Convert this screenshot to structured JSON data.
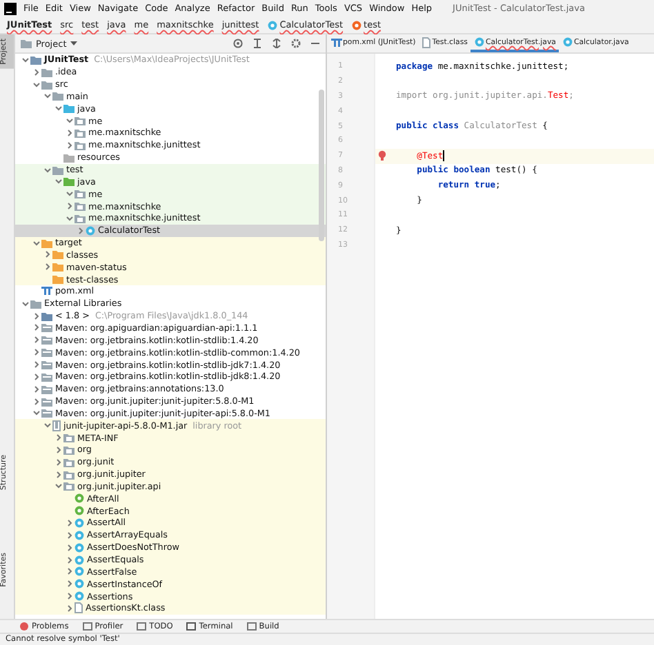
{
  "menu": [
    "File",
    "Edit",
    "View",
    "Navigate",
    "Code",
    "Analyze",
    "Refactor",
    "Build",
    "Run",
    "Tools",
    "VCS",
    "Window",
    "Help"
  ],
  "window": {
    "title": "JUnitTest - CalculatorTest.java"
  },
  "breadcrumbs": [
    {
      "label": "JUnitTest",
      "kind": "module"
    },
    {
      "label": "src",
      "kind": "folder"
    },
    {
      "label": "test",
      "kind": "folder"
    },
    {
      "label": "java",
      "kind": "folder"
    },
    {
      "label": "me",
      "kind": "folder"
    },
    {
      "label": "maxnitschke",
      "kind": "folder"
    },
    {
      "label": "junittest",
      "kind": "folder"
    },
    {
      "label": "CalculatorTest",
      "kind": "class"
    },
    {
      "label": "test",
      "kind": "method"
    }
  ],
  "side_stripe": [
    {
      "label": "Project",
      "selected": true
    },
    {
      "label": "Structure",
      "selected": false
    },
    {
      "label": "Favorites",
      "selected": false
    }
  ],
  "project": {
    "title": "Project",
    "tree": [
      {
        "label": "JUnitTest",
        "hint": "C:\\Users\\Max\\IdeaProjects\\JUnitTest",
        "kind": "module",
        "expanded": true,
        "children": [
          {
            "label": ".idea",
            "kind": "folder",
            "expanded": false
          },
          {
            "label": "src",
            "kind": "folder",
            "expanded": true,
            "children": [
              {
                "label": "main",
                "kind": "folder",
                "expanded": true,
                "children": [
                  {
                    "label": "java",
                    "kind": "source",
                    "expanded": true,
                    "children": [
                      {
                        "label": "me",
                        "kind": "package",
                        "expanded": true
                      },
                      {
                        "label": "me.maxnitschke",
                        "kind": "package",
                        "expanded": false
                      },
                      {
                        "label": "me.maxnitschke.junittest",
                        "kind": "package",
                        "expanded": false
                      }
                    ]
                  },
                  {
                    "label": "resources",
                    "kind": "resources"
                  }
                ]
              },
              {
                "label": "test",
                "kind": "folder",
                "color": "#eff9ea",
                "expanded": true,
                "children": [
                  {
                    "label": "java",
                    "kind": "test",
                    "expanded": true,
                    "children": [
                      {
                        "label": "me",
                        "kind": "package",
                        "expanded": true
                      },
                      {
                        "label": "me.maxnitschke",
                        "kind": "package",
                        "expanded": false
                      },
                      {
                        "label": "me.maxnitschke.junittest",
                        "kind": "package",
                        "expanded": true,
                        "children": [
                          {
                            "label": "CalculatorTest",
                            "kind": "class",
                            "expanded": false,
                            "selected": true
                          }
                        ]
                      }
                    ]
                  }
                ]
              }
            ]
          },
          {
            "label": "target",
            "kind": "excluded",
            "color": "#fdfbe3",
            "expanded": true,
            "children": [
              {
                "label": "classes",
                "kind": "excluded",
                "expanded": false
              },
              {
                "label": "maven-status",
                "kind": "excluded",
                "expanded": false
              },
              {
                "label": "test-classes",
                "kind": "excluded"
              }
            ]
          },
          {
            "label": "pom.xml",
            "kind": "xml"
          }
        ]
      },
      {
        "label": "External Libraries",
        "kind": "libraries",
        "expanded": true,
        "children": [
          {
            "label": "< 1.8 >",
            "hint": "C:\\Program Files\\Java\\jdk1.8.0_144",
            "kind": "jdk",
            "expanded": false
          },
          {
            "label": "Maven: org.apiguardian:apiguardian-api:1.1.1",
            "kind": "library",
            "expanded": false
          },
          {
            "label": "Maven: org.jetbrains.kotlin:kotlin-stdlib:1.4.20",
            "kind": "library",
            "expanded": false
          },
          {
            "label": "Maven: org.jetbrains.kotlin:kotlin-stdlib-common:1.4.20",
            "kind": "library",
            "expanded": false
          },
          {
            "label": "Maven: org.jetbrains.kotlin:kotlin-stdlib-jdk7:1.4.20",
            "kind": "library",
            "expanded": false
          },
          {
            "label": "Maven: org.jetbrains.kotlin:kotlin-stdlib-jdk8:1.4.20",
            "kind": "library",
            "expanded": false
          },
          {
            "label": "Maven: org.jetbrains:annotations:13.0",
            "kind": "library",
            "expanded": false
          },
          {
            "label": "Maven: org.junit.jupiter:junit-jupiter:5.8.0-M1",
            "kind": "library",
            "expanded": false
          },
          {
            "label": "Maven: org.junit.jupiter:junit-jupiter-api:5.8.0-M1",
            "kind": "library",
            "expanded": true,
            "children": [
              {
                "label": "junit-jupiter-api-5.8.0-M1.jar",
                "hint": "library root",
                "kind": "jar",
                "color": "#fdfbe3",
                "expanded": true,
                "children": [
                  {
                    "label": "META-INF",
                    "kind": "package",
                    "expanded": false
                  },
                  {
                    "label": "org",
                    "kind": "package",
                    "expanded": false
                  },
                  {
                    "label": "org.junit",
                    "kind": "package",
                    "expanded": false
                  },
                  {
                    "label": "org.junit.jupiter",
                    "kind": "package",
                    "expanded": false
                  },
                  {
                    "label": "org.junit.jupiter.api",
                    "kind": "package",
                    "expanded": true,
                    "children": [
                      {
                        "label": "AfterAll",
                        "kind": "annotation"
                      },
                      {
                        "label": "AfterEach",
                        "kind": "annotation"
                      },
                      {
                        "label": "AssertAll",
                        "kind": "compiled",
                        "expanded": false
                      },
                      {
                        "label": "AssertArrayEquals",
                        "kind": "compiled",
                        "expanded": false
                      },
                      {
                        "label": "AssertDoesNotThrow",
                        "kind": "compiled",
                        "expanded": false
                      },
                      {
                        "label": "AssertEquals",
                        "kind": "compiled",
                        "expanded": false
                      },
                      {
                        "label": "AssertFalse",
                        "kind": "compiled",
                        "expanded": false
                      },
                      {
                        "label": "AssertInstanceOf",
                        "kind": "compiled",
                        "expanded": false
                      },
                      {
                        "label": "Assertions",
                        "kind": "compiled",
                        "expanded": false
                      },
                      {
                        "label": "AssertionsKt.class",
                        "kind": "file",
                        "expanded": false
                      }
                    ]
                  }
                ]
              }
            ]
          }
        ]
      }
    ]
  },
  "editor": {
    "tabs": [
      {
        "label": "pom.xml (JUnitTest)",
        "kind": "xml",
        "selected": false
      },
      {
        "label": "Test.class",
        "kind": "file",
        "selected": false
      },
      {
        "label": "CalculatorTest.java",
        "kind": "class",
        "selected": true
      },
      {
        "label": "Calculator.java",
        "kind": "class",
        "selected": false
      }
    ],
    "lines": [
      {
        "number": "1",
        "tokens": [
          {
            "text": "package",
            "kind": "keyword"
          },
          {
            "text": " me.maxnitschke.junittest;",
            "kind": "plain"
          }
        ]
      },
      {
        "number": "2"
      },
      {
        "number": "3",
        "tokens": [
          {
            "text": "import org.junit.jupiter.api.",
            "kind": "unused"
          },
          {
            "text": "Test",
            "kind": "error"
          },
          {
            "text": ";",
            "kind": "unused"
          }
        ]
      },
      {
        "number": "4"
      },
      {
        "number": "5",
        "tokens": [
          {
            "text": "public class",
            "kind": "keyword"
          },
          {
            "text": " CalculatorTest ",
            "kind": "unused"
          },
          {
            "text": "{",
            "kind": "plain"
          }
        ]
      },
      {
        "number": "6"
      },
      {
        "number": "7",
        "current": true,
        "bulb": true,
        "tokens": [
          {
            "text": "    @Test",
            "kind": "error"
          }
        ]
      },
      {
        "number": "8",
        "tokens": [
          {
            "text": "    public boolean",
            "kind": "keyword"
          },
          {
            "text": " test() {",
            "kind": "plain"
          }
        ]
      },
      {
        "number": "9",
        "tokens": [
          {
            "text": "        return true",
            "kind": "keyword"
          },
          {
            "text": ";",
            "kind": "plain"
          }
        ]
      },
      {
        "number": "10",
        "tokens": [
          {
            "text": "    }",
            "kind": "plain"
          }
        ]
      },
      {
        "number": "11"
      },
      {
        "number": "12",
        "tokens": [
          {
            "text": "}",
            "kind": "plain"
          }
        ]
      },
      {
        "number": "13"
      }
    ]
  },
  "tool_windows": [
    {
      "label": "Problems",
      "kind": "problems"
    },
    {
      "label": "Profiler",
      "kind": "profiler"
    },
    {
      "label": "TODO",
      "kind": "todo"
    },
    {
      "label": "Terminal",
      "kind": "terminal"
    },
    {
      "label": "Build",
      "kind": "build"
    }
  ],
  "status_bar": {
    "message": "Cannot resolve symbol 'Test'"
  }
}
